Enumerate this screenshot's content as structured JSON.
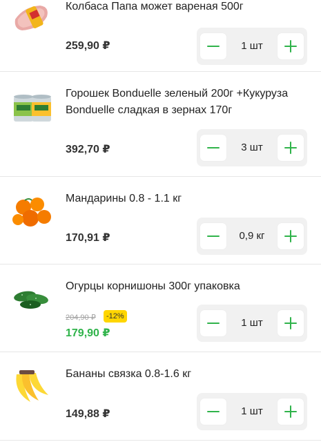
{
  "colors": {
    "accent": "#2fb34a",
    "badge": "#ffd600",
    "stepper_bg": "#f1f1f1"
  },
  "items": [
    {
      "name": "Колбаса Папа может вареная 500г",
      "price": "259,90 ₽",
      "qty": "1 шт",
      "image": "sausage-image"
    },
    {
      "name": "Горошек Bonduelle зеленый 200г +Кукуруза Bonduelle сладкая в зернах 170г",
      "price": "392,70 ₽",
      "qty": "3 шт",
      "image": "canned-vegetables-image"
    },
    {
      "name": "Мандарины 0.8 - 1.1 кг",
      "price": "170,91 ₽",
      "qty": "0,9 кг",
      "image": "tangerines-image"
    },
    {
      "name": "Огурцы корнишоны 300г упаковка",
      "old_price": "204,90 ₽",
      "discount": "-12%",
      "price": "179,90 ₽",
      "qty": "1 шт",
      "image": "cucumbers-image"
    },
    {
      "name": "Бананы связка 0.8-1.6 кг",
      "price": "149,88 ₽",
      "qty": "1 шт",
      "image": "bananas-image"
    }
  ]
}
